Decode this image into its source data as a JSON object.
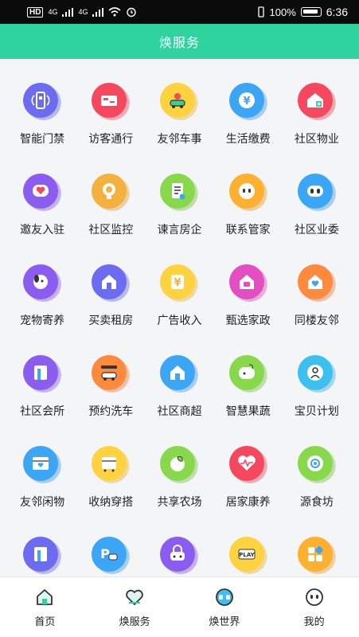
{
  "status_bar": {
    "hd": "HD",
    "net1": "4G",
    "net2": "4G",
    "battery": "100%",
    "time": "6:36"
  },
  "header": {
    "title": "焕服务"
  },
  "services": [
    {
      "label": "智能门禁",
      "color": "#6c6cf2",
      "icon": "door-access-icon"
    },
    {
      "label": "访客通行",
      "color": "#f5475e",
      "icon": "visitor-card-icon"
    },
    {
      "label": "友邻车事",
      "color": "#ffd23f",
      "icon": "car-location-icon"
    },
    {
      "label": "生活缴费",
      "color": "#3ba6f5",
      "icon": "yen-coin-icon"
    },
    {
      "label": "社区物业",
      "color": "#f5475e",
      "icon": "house-plus-icon"
    },
    {
      "label": "邀友入驻",
      "color": "#8a5cf0",
      "icon": "heart-chat-icon"
    },
    {
      "label": "社区监控",
      "color": "#f5b13d",
      "icon": "camera-icon"
    },
    {
      "label": "谏言房企",
      "color": "#87d94b",
      "icon": "document-icon"
    },
    {
      "label": "联系管家",
      "color": "#ffb02e",
      "icon": "butler-face-icon"
    },
    {
      "label": "社区业委",
      "color": "#3ba6f5",
      "icon": "committee-face-icon"
    },
    {
      "label": "宠物寄养",
      "color": "#8a5cf0",
      "icon": "pet-dog-icon"
    },
    {
      "label": "买卖租房",
      "color": "#6c6cf2",
      "icon": "house-icon"
    },
    {
      "label": "广告收入",
      "color": "#ffd23f",
      "icon": "yen-sign-icon"
    },
    {
      "label": "甄选家政",
      "color": "#e34fc3",
      "icon": "housekeeping-icon"
    },
    {
      "label": "同楼友邻",
      "color": "#ff8a3d",
      "icon": "neighbor-heart-icon"
    },
    {
      "label": "社区会所",
      "color": "#8a5cf0",
      "icon": "clubhouse-icon"
    },
    {
      "label": "预约洗车",
      "color": "#ff8a3d",
      "icon": "car-wash-icon"
    },
    {
      "label": "社区商超",
      "color": "#3ba6f5",
      "icon": "store-icon"
    },
    {
      "label": "智慧果蔬",
      "color": "#87d94b",
      "icon": "fruit-icon"
    },
    {
      "label": "宝贝计划",
      "color": "#3bc0f0",
      "icon": "baby-icon"
    },
    {
      "label": "友邻闲物",
      "color": "#3ba6f5",
      "icon": "secondhand-box-icon"
    },
    {
      "label": "收纳穿搭",
      "color": "#ffd23f",
      "icon": "wardrobe-icon"
    },
    {
      "label": "共享农场",
      "color": "#87d94b",
      "icon": "farm-leaf-icon"
    },
    {
      "label": "居家康养",
      "color": "#f5475e",
      "icon": "health-heart-icon"
    },
    {
      "label": "源食坊",
      "color": "#87d94b",
      "icon": "food-gear-icon"
    },
    {
      "label": "",
      "color": "#6c6cf2",
      "icon": "card-icon"
    },
    {
      "label": "",
      "color": "#3ba6f5",
      "icon": "parking-icon"
    },
    {
      "label": "",
      "color": "#8a5cf0",
      "icon": "locked-car-icon"
    },
    {
      "label": "",
      "color": "#ffd23f",
      "icon": "play-icon"
    },
    {
      "label": "",
      "color": "#ffb02e",
      "icon": "apps-grid-icon"
    }
  ],
  "bottom_nav": [
    {
      "label": "首页",
      "icon": "home-icon"
    },
    {
      "label": "焕服务",
      "icon": "service-heart-icon"
    },
    {
      "label": "焕世界",
      "icon": "world-face-icon"
    },
    {
      "label": "我的",
      "icon": "profile-face-icon"
    }
  ]
}
